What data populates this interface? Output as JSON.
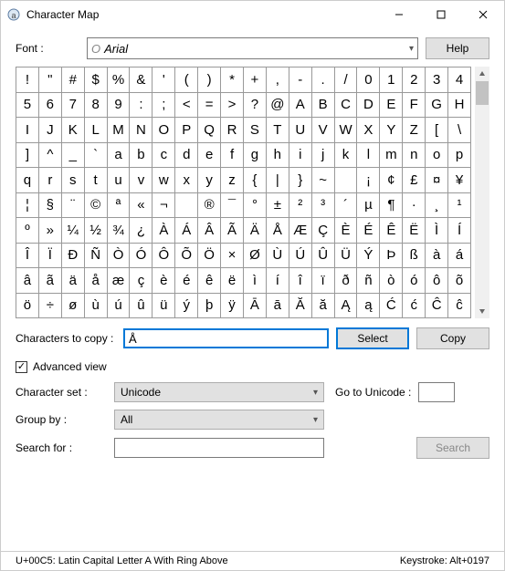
{
  "window": {
    "title": "Character Map"
  },
  "font": {
    "label": "Font :",
    "value": "Arial",
    "icon_letter": "O",
    "help": "Help"
  },
  "grid": [
    "!",
    "\"",
    "#",
    "$",
    "%",
    "&",
    "'",
    "(",
    ")",
    "*",
    "+",
    ",",
    "-",
    ".",
    "/",
    "0",
    "1",
    "2",
    "3",
    "4",
    "5",
    "6",
    "7",
    "8",
    "9",
    ":",
    ";",
    "<",
    "=",
    ">",
    "?",
    "@",
    "A",
    "B",
    "C",
    "D",
    "E",
    "F",
    "G",
    "H",
    "I",
    "J",
    "K",
    "L",
    "M",
    "N",
    "O",
    "P",
    "Q",
    "R",
    "S",
    "T",
    "U",
    "V",
    "W",
    "X",
    "Y",
    "Z",
    "[",
    "\\",
    "]",
    "^",
    "_",
    "`",
    "a",
    "b",
    "c",
    "d",
    "e",
    "f",
    "g",
    "h",
    "i",
    "j",
    "k",
    "l",
    "m",
    "n",
    "o",
    "p",
    "q",
    "r",
    "s",
    "t",
    "u",
    "v",
    "w",
    "x",
    "y",
    "z",
    "{",
    "|",
    "}",
    "~",
    "",
    "¡",
    "¢",
    "£",
    "¤",
    "¥",
    "¦",
    "§",
    "¨",
    "©",
    "ª",
    "«",
    "¬",
    "­",
    "®",
    "¯",
    "°",
    "±",
    "²",
    "³",
    "´",
    "µ",
    "¶",
    "·",
    "¸",
    "¹",
    "º",
    "»",
    "¼",
    "½",
    "¾",
    "¿",
    "À",
    "Á",
    "Â",
    "Ã",
    "Ä",
    "Å",
    "Æ",
    "Ç",
    "È",
    "É",
    "Ê",
    "Ë",
    "Ì",
    "Í",
    "Î",
    "Ï",
    "Ð",
    "Ñ",
    "Ò",
    "Ó",
    "Ô",
    "Õ",
    "Ö",
    "×",
    "Ø",
    "Ù",
    "Ú",
    "Û",
    "Ü",
    "Ý",
    "Þ",
    "ß",
    "à",
    "á",
    "â",
    "ã",
    "ä",
    "å",
    "æ",
    "ç",
    "è",
    "é",
    "ê",
    "ë",
    "ì",
    "í",
    "î",
    "ï",
    "ð",
    "ñ",
    "ò",
    "ó",
    "ô",
    "õ",
    "ö",
    "÷",
    "ø",
    "ù",
    "ú",
    "û",
    "ü",
    "ý",
    "þ",
    "ÿ",
    "Ā",
    "ā",
    "Ă",
    "ă",
    "Ą",
    "ą",
    "Ć",
    "ć",
    "Ĉ",
    "ĉ"
  ],
  "copy": {
    "label": "Characters to copy :",
    "value": "Å",
    "select": "Select",
    "copy": "Copy"
  },
  "advanced": {
    "label": "Advanced view",
    "checked": true
  },
  "charset": {
    "label": "Character set :",
    "value": "Unicode"
  },
  "goto": {
    "label": "Go to Unicode :",
    "value": ""
  },
  "groupby": {
    "label": "Group by :",
    "value": "All"
  },
  "search": {
    "label": "Search for :",
    "value": "",
    "button": "Search"
  },
  "status": {
    "left": "U+00C5: Latin Capital Letter A With Ring Above",
    "right": "Keystroke: Alt+0197"
  }
}
